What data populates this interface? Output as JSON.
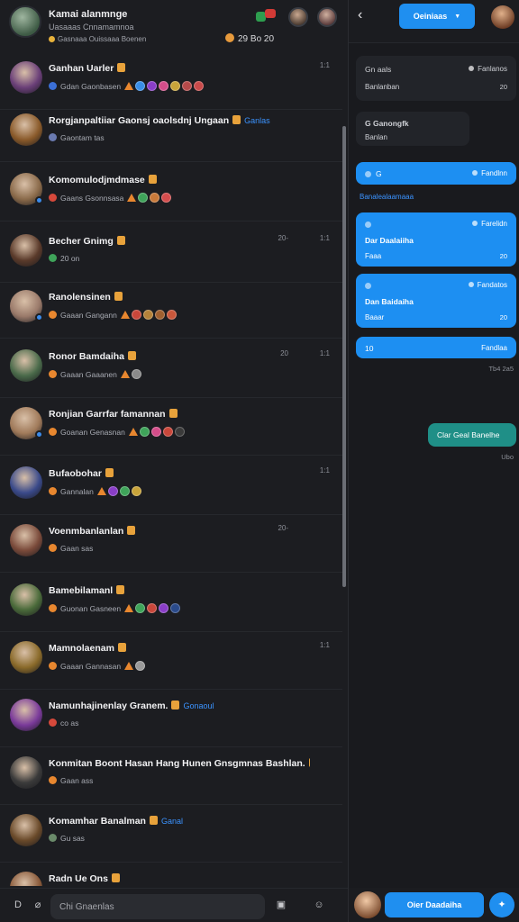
{
  "header": {
    "title": "Kamai alanmnge",
    "subtitle": "Uasaaas Cnnamamnoa",
    "subtitle2": "Gasnaaa Ouissaaa Boenen",
    "stats": "29 Bo 20"
  },
  "conversations": [
    {
      "name": "Ganhan Uarler",
      "tag": "",
      "status": "Gdan Gaonbasen",
      "time": "1:1",
      "time2": "",
      "avatar_color": "#6a3f78",
      "status_color": "#3b6fd6",
      "badges": [
        "#3a8ee6",
        "#8a3ec7",
        "#d44d8a",
        "#c9a43a",
        "#b64a4a",
        "#c94a4a"
      ],
      "online": false
    },
    {
      "name": "Rorgjanpaltiiar Gaonsj oaolsdnj Ungaan",
      "tag": "Ganlas",
      "status": "Gaontam tas",
      "time": "",
      "time2": "",
      "avatar_color": "#8a5a2a",
      "status_color": "#6a7ab0",
      "badges": [],
      "online": false
    },
    {
      "name": "Komomulodjmdmase",
      "tag": "",
      "status": "Gaans Gsonnsasa",
      "time": "",
      "time2": "",
      "avatar_color": "#8a6a4a",
      "status_color": "#d6493b",
      "badges": [
        "#3fa45a",
        "#c97a3a",
        "#d44d4d"
      ],
      "online": true
    },
    {
      "name": "Becher Gnimg",
      "tag": "",
      "status": "20 on",
      "time": "1:1",
      "time2": "20-",
      "avatar_color": "#5a3a2a",
      "status_color": "#3fa45a",
      "badges": [],
      "online": false
    },
    {
      "name": "Ranolensinen",
      "tag": "",
      "status": "Gaaan Gangann",
      "time": "",
      "time2": "",
      "avatar_color": "#9a7a6a",
      "status_color": "#e8872f",
      "badges": [
        "#c9473b",
        "#b5823a",
        "#a06030",
        "#c9573b"
      ],
      "online": true
    },
    {
      "name": "Ronor Bamdaiha",
      "tag": "",
      "status": "Gaaan Gaaanen",
      "time": "1:1",
      "time2": "20",
      "avatar_color": "#4a6a4a",
      "status_color": "#e8872f",
      "badges": [
        "#8a8a8a"
      ],
      "online": false
    },
    {
      "name": "Ronjian Garrfar famannan",
      "tag": "",
      "status": "Goanan Genasnan",
      "time": "",
      "time2": "",
      "avatar_color": "#a07a5a",
      "status_color": "#e8872f",
      "badges": [
        "#3fa45a",
        "#d44d8a",
        "#c9473b",
        "#3a3a3a"
      ],
      "online": true
    },
    {
      "name": "Bufaobohar",
      "tag": "",
      "status": "Gannalan",
      "time": "1:1",
      "time2": "",
      "avatar_color": "#3a4a8a",
      "status_color": "#e8872f",
      "badges": [
        "#8a3ec7",
        "#3fa45a",
        "#c9a43a"
      ],
      "online": false
    },
    {
      "name": "Voenmbanlanlan",
      "tag": "",
      "status": "Gaan sas",
      "time": "",
      "time2": "20-",
      "avatar_color": "#7a4a3a",
      "status_color": "#e8872f",
      "badges": [],
      "online": false
    },
    {
      "name": "Bamebilamanl",
      "tag": "",
      "status": "Guonan Gasneen",
      "time": "",
      "time2": "",
      "avatar_color": "#4a6a3a",
      "status_color": "#e8872f",
      "badges": [
        "#3fa45a",
        "#c9473b",
        "#8a3ec7",
        "#2a4a8a"
      ],
      "online": false
    },
    {
      "name": "Mamnolaenam",
      "tag": "",
      "status": "Gaaan Gannasan",
      "time": "1:1",
      "time2": "",
      "avatar_color": "#8a6a2a",
      "status_color": "#e8872f",
      "badges": [
        "#9a9a9a"
      ],
      "online": false
    },
    {
      "name": "Namunhajinenlay Granem.",
      "tag": "Gonaoul",
      "status": "co as",
      "time": "",
      "time2": "",
      "avatar_color": "#7a3a9a",
      "status_color": "#d6493b",
      "badges": [],
      "online": false
    },
    {
      "name": "Konmitan Boont Hasan Hang Hunen Gnsgmnas Bashlan.",
      "tag": "",
      "status": "Gaan ass",
      "time": "",
      "time2": "",
      "avatar_color": "#3a3a3a",
      "status_color": "#e8872f",
      "badges": [],
      "online": false
    },
    {
      "name": "Komamhar Banalman",
      "tag": "Ganal",
      "status": "Gu sas",
      "time": "",
      "time2": "",
      "avatar_color": "#6a4a2a",
      "status_color": "#6a8a6a",
      "badges": [],
      "online": false
    },
    {
      "name": "Radn Ue Ons",
      "tag": "",
      "status": "Gaans Gaen",
      "time": "",
      "time2": "",
      "avatar_color": "#8a5a3a",
      "status_color": "#c9a43a",
      "badges": [
        "#3a8ee6",
        "#c9473b",
        "#3fa45a"
      ],
      "online": true
    }
  ],
  "composer": {
    "placeholder": "Chi Gnaenlas"
  },
  "right": {
    "action_label": "Oeiniaas",
    "cards": {
      "c1_left": "Gn aals",
      "c1_right": "Fanlanos",
      "c1_sub": "Banlanban",
      "c1_time": "20",
      "c2_title": "G Ganongfk",
      "c2_sub": "Banlan",
      "c3_left": "G",
      "c3_right": "Fandlnn",
      "link": "Banalealaamaaa",
      "c4_right": "Farelidn",
      "c4_title": "Dar Daalaiiha",
      "c4_sub": "Faaa",
      "c4_time": "20",
      "c5_right": "Fandatos",
      "c5_title": "Dan Baidaiha",
      "c5_sub": "Baaar",
      "c5_time": "20",
      "c6_left": "10",
      "c6_right": "Fandlaa",
      "stamp1": "Tb4 2a5",
      "c7_text": "Clar Geal Banelhe",
      "stamp2": "Ubo"
    },
    "footer_btn": "Oier Daadaiha"
  }
}
